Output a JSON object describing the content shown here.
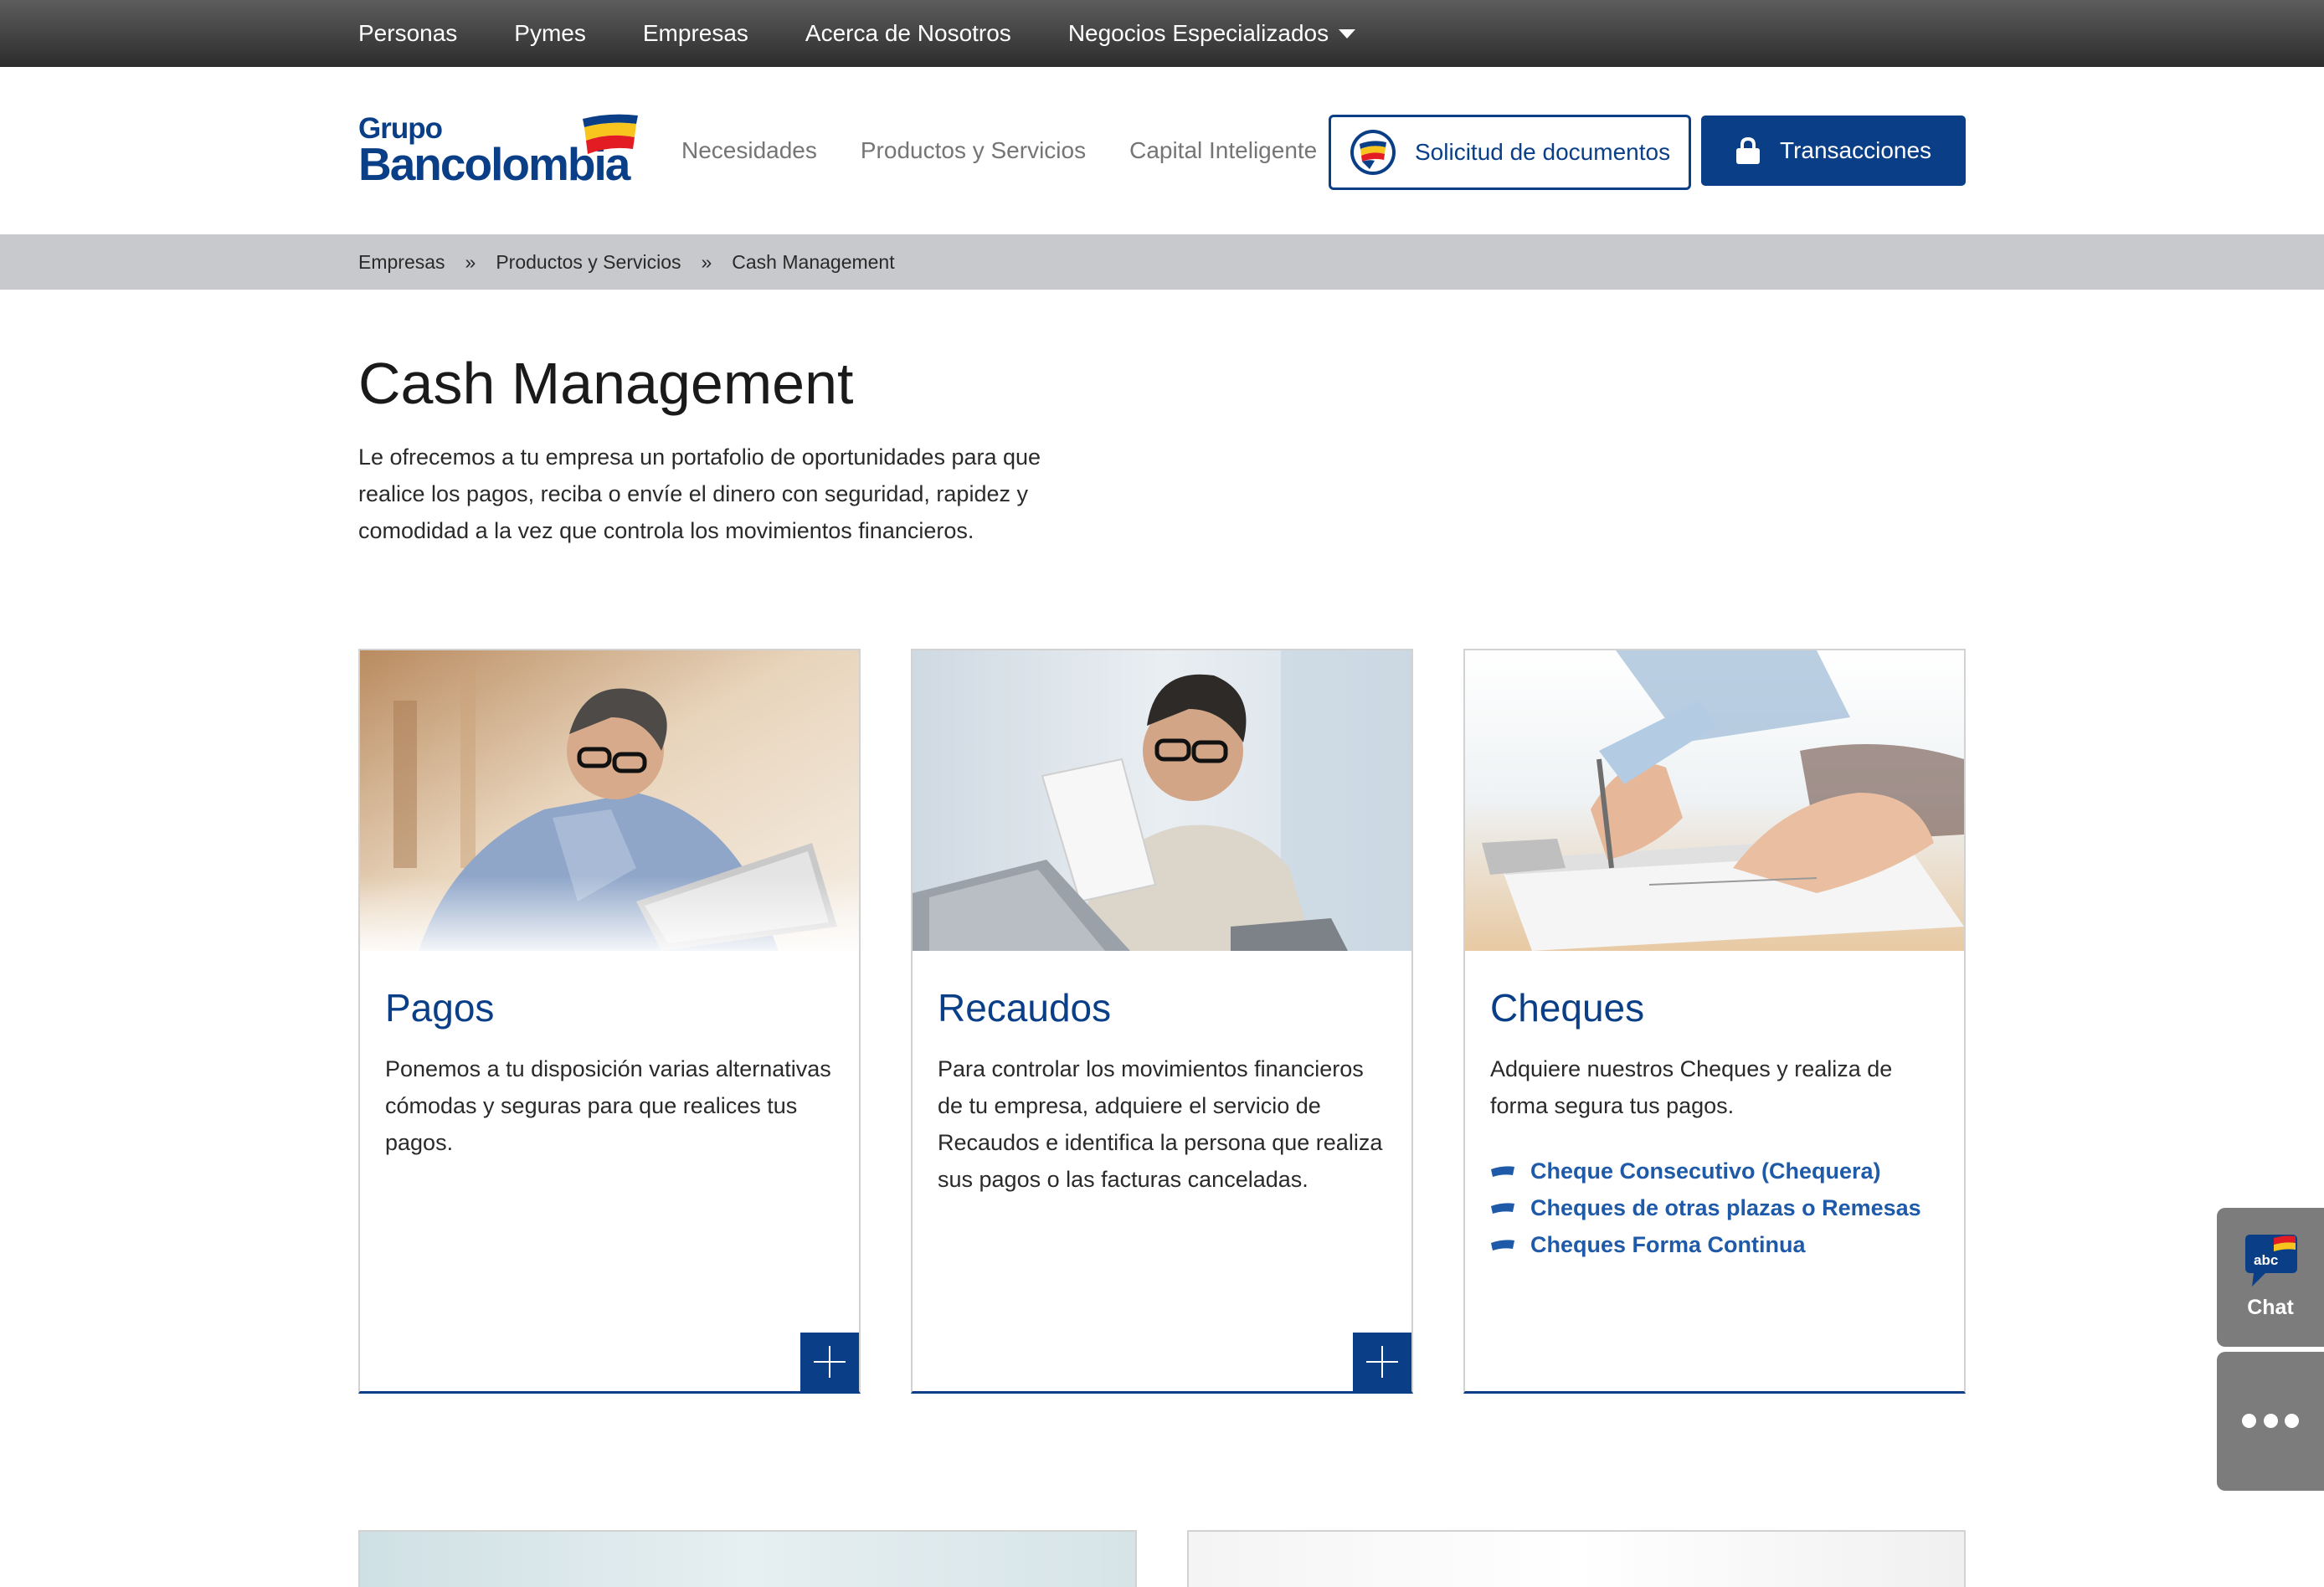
{
  "topbar": {
    "items": [
      {
        "label": "Personas"
      },
      {
        "label": "Pymes"
      },
      {
        "label": "Empresas"
      },
      {
        "label": "Acerca de Nosotros"
      },
      {
        "label": "Negocios Especializados"
      }
    ]
  },
  "header": {
    "logo": {
      "line1": "Grupo",
      "line2": "Bancolombia"
    },
    "nav": [
      {
        "label": "Necesidades"
      },
      {
        "label": "Productos y Servicios"
      },
      {
        "label": "Capital Inteligente"
      }
    ],
    "documents_button": "Solicitud de documentos",
    "transactions_button": "Transacciones"
  },
  "breadcrumb": {
    "items": [
      "Empresas",
      "Productos y Servicios",
      "Cash Management"
    ],
    "separator": "»"
  },
  "intro": {
    "title": "Cash Management",
    "text": "Le ofrecemos a tu empresa un portafolio de oportunidades para que realice los pagos, reciba o envíe el dinero con seguridad, rapidez y comodidad a la vez que controla los movimientos financieros."
  },
  "cards": [
    {
      "title": "Pagos",
      "text": "Ponemos a tu  disposición varias alternativas cómodas y seguras para que realices tus pagos."
    },
    {
      "title": "Recaudos",
      "text": "Para controlar los movimientos financieros de tu empresa, adquiere  el servicio de Recaudos e identifica la persona que realiza sus pagos o las facturas canceladas."
    },
    {
      "title": "Cheques",
      "text": "Adquiere nuestros Cheques y realiza de forma segura tus pagos.",
      "links": [
        "Cheque Consecutivo (Chequera)",
        "Cheques de otras plazas o Remesas",
        "Cheques Forma Continua"
      ]
    }
  ],
  "chat": {
    "badge": "abc",
    "label": "Chat"
  },
  "colors": {
    "brand_blue": "#0a3f88",
    "link_blue": "#1e5aa8",
    "flag_yellow": "#f7c51e",
    "flag_red": "#e31b23",
    "breadcrumb_bg": "#c8c9cc",
    "widget_gray": "#7c7c7c"
  },
  "icons": {
    "nav_dropdown": "caret-down-icon",
    "documents": "bank-logo-badge-icon",
    "transactions": "lock-icon",
    "card_expand": "plus-icon",
    "list_bullet": "flag-bullet-icon",
    "more": "more-dots-icon"
  }
}
